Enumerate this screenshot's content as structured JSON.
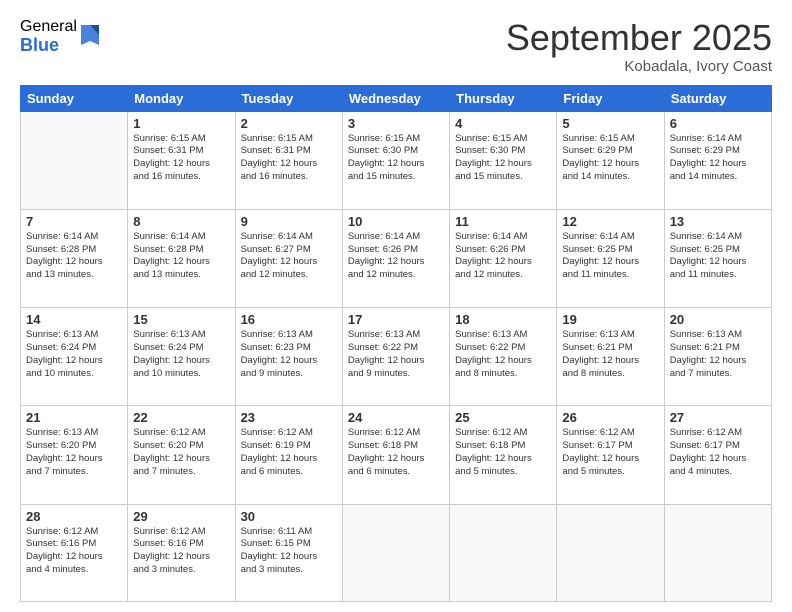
{
  "logo": {
    "general": "General",
    "blue": "Blue"
  },
  "header": {
    "month": "September 2025",
    "location": "Kobadala, Ivory Coast"
  },
  "days_of_week": [
    "Sunday",
    "Monday",
    "Tuesday",
    "Wednesday",
    "Thursday",
    "Friday",
    "Saturday"
  ],
  "weeks": [
    [
      {
        "day": "",
        "sunrise": "",
        "sunset": "",
        "daylight": ""
      },
      {
        "day": "1",
        "sunrise": "Sunrise: 6:15 AM",
        "sunset": "Sunset: 6:31 PM",
        "daylight": "Daylight: 12 hours and 16 minutes."
      },
      {
        "day": "2",
        "sunrise": "Sunrise: 6:15 AM",
        "sunset": "Sunset: 6:31 PM",
        "daylight": "Daylight: 12 hours and 16 minutes."
      },
      {
        "day": "3",
        "sunrise": "Sunrise: 6:15 AM",
        "sunset": "Sunset: 6:30 PM",
        "daylight": "Daylight: 12 hours and 15 minutes."
      },
      {
        "day": "4",
        "sunrise": "Sunrise: 6:15 AM",
        "sunset": "Sunset: 6:30 PM",
        "daylight": "Daylight: 12 hours and 15 minutes."
      },
      {
        "day": "5",
        "sunrise": "Sunrise: 6:15 AM",
        "sunset": "Sunset: 6:29 PM",
        "daylight": "Daylight: 12 hours and 14 minutes."
      },
      {
        "day": "6",
        "sunrise": "Sunrise: 6:14 AM",
        "sunset": "Sunset: 6:29 PM",
        "daylight": "Daylight: 12 hours and 14 minutes."
      }
    ],
    [
      {
        "day": "7",
        "sunrise": "Sunrise: 6:14 AM",
        "sunset": "Sunset: 6:28 PM",
        "daylight": "Daylight: 12 hours and 13 minutes."
      },
      {
        "day": "8",
        "sunrise": "Sunrise: 6:14 AM",
        "sunset": "Sunset: 6:28 PM",
        "daylight": "Daylight: 12 hours and 13 minutes."
      },
      {
        "day": "9",
        "sunrise": "Sunrise: 6:14 AM",
        "sunset": "Sunset: 6:27 PM",
        "daylight": "Daylight: 12 hours and 12 minutes."
      },
      {
        "day": "10",
        "sunrise": "Sunrise: 6:14 AM",
        "sunset": "Sunset: 6:26 PM",
        "daylight": "Daylight: 12 hours and 12 minutes."
      },
      {
        "day": "11",
        "sunrise": "Sunrise: 6:14 AM",
        "sunset": "Sunset: 6:26 PM",
        "daylight": "Daylight: 12 hours and 12 minutes."
      },
      {
        "day": "12",
        "sunrise": "Sunrise: 6:14 AM",
        "sunset": "Sunset: 6:25 PM",
        "daylight": "Daylight: 12 hours and 11 minutes."
      },
      {
        "day": "13",
        "sunrise": "Sunrise: 6:14 AM",
        "sunset": "Sunset: 6:25 PM",
        "daylight": "Daylight: 12 hours and 11 minutes."
      }
    ],
    [
      {
        "day": "14",
        "sunrise": "Sunrise: 6:13 AM",
        "sunset": "Sunset: 6:24 PM",
        "daylight": "Daylight: 12 hours and 10 minutes."
      },
      {
        "day": "15",
        "sunrise": "Sunrise: 6:13 AM",
        "sunset": "Sunset: 6:24 PM",
        "daylight": "Daylight: 12 hours and 10 minutes."
      },
      {
        "day": "16",
        "sunrise": "Sunrise: 6:13 AM",
        "sunset": "Sunset: 6:23 PM",
        "daylight": "Daylight: 12 hours and 9 minutes."
      },
      {
        "day": "17",
        "sunrise": "Sunrise: 6:13 AM",
        "sunset": "Sunset: 6:22 PM",
        "daylight": "Daylight: 12 hours and 9 minutes."
      },
      {
        "day": "18",
        "sunrise": "Sunrise: 6:13 AM",
        "sunset": "Sunset: 6:22 PM",
        "daylight": "Daylight: 12 hours and 8 minutes."
      },
      {
        "day": "19",
        "sunrise": "Sunrise: 6:13 AM",
        "sunset": "Sunset: 6:21 PM",
        "daylight": "Daylight: 12 hours and 8 minutes."
      },
      {
        "day": "20",
        "sunrise": "Sunrise: 6:13 AM",
        "sunset": "Sunset: 6:21 PM",
        "daylight": "Daylight: 12 hours and 7 minutes."
      }
    ],
    [
      {
        "day": "21",
        "sunrise": "Sunrise: 6:13 AM",
        "sunset": "Sunset: 6:20 PM",
        "daylight": "Daylight: 12 hours and 7 minutes."
      },
      {
        "day": "22",
        "sunrise": "Sunrise: 6:12 AM",
        "sunset": "Sunset: 6:20 PM",
        "daylight": "Daylight: 12 hours and 7 minutes."
      },
      {
        "day": "23",
        "sunrise": "Sunrise: 6:12 AM",
        "sunset": "Sunset: 6:19 PM",
        "daylight": "Daylight: 12 hours and 6 minutes."
      },
      {
        "day": "24",
        "sunrise": "Sunrise: 6:12 AM",
        "sunset": "Sunset: 6:18 PM",
        "daylight": "Daylight: 12 hours and 6 minutes."
      },
      {
        "day": "25",
        "sunrise": "Sunrise: 6:12 AM",
        "sunset": "Sunset: 6:18 PM",
        "daylight": "Daylight: 12 hours and 5 minutes."
      },
      {
        "day": "26",
        "sunrise": "Sunrise: 6:12 AM",
        "sunset": "Sunset: 6:17 PM",
        "daylight": "Daylight: 12 hours and 5 minutes."
      },
      {
        "day": "27",
        "sunrise": "Sunrise: 6:12 AM",
        "sunset": "Sunset: 6:17 PM",
        "daylight": "Daylight: 12 hours and 4 minutes."
      }
    ],
    [
      {
        "day": "28",
        "sunrise": "Sunrise: 6:12 AM",
        "sunset": "Sunset: 6:16 PM",
        "daylight": "Daylight: 12 hours and 4 minutes."
      },
      {
        "day": "29",
        "sunrise": "Sunrise: 6:12 AM",
        "sunset": "Sunset: 6:16 PM",
        "daylight": "Daylight: 12 hours and 3 minutes."
      },
      {
        "day": "30",
        "sunrise": "Sunrise: 6:11 AM",
        "sunset": "Sunset: 6:15 PM",
        "daylight": "Daylight: 12 hours and 3 minutes."
      },
      {
        "day": "",
        "sunrise": "",
        "sunset": "",
        "daylight": ""
      },
      {
        "day": "",
        "sunrise": "",
        "sunset": "",
        "daylight": ""
      },
      {
        "day": "",
        "sunrise": "",
        "sunset": "",
        "daylight": ""
      },
      {
        "day": "",
        "sunrise": "",
        "sunset": "",
        "daylight": ""
      }
    ]
  ]
}
